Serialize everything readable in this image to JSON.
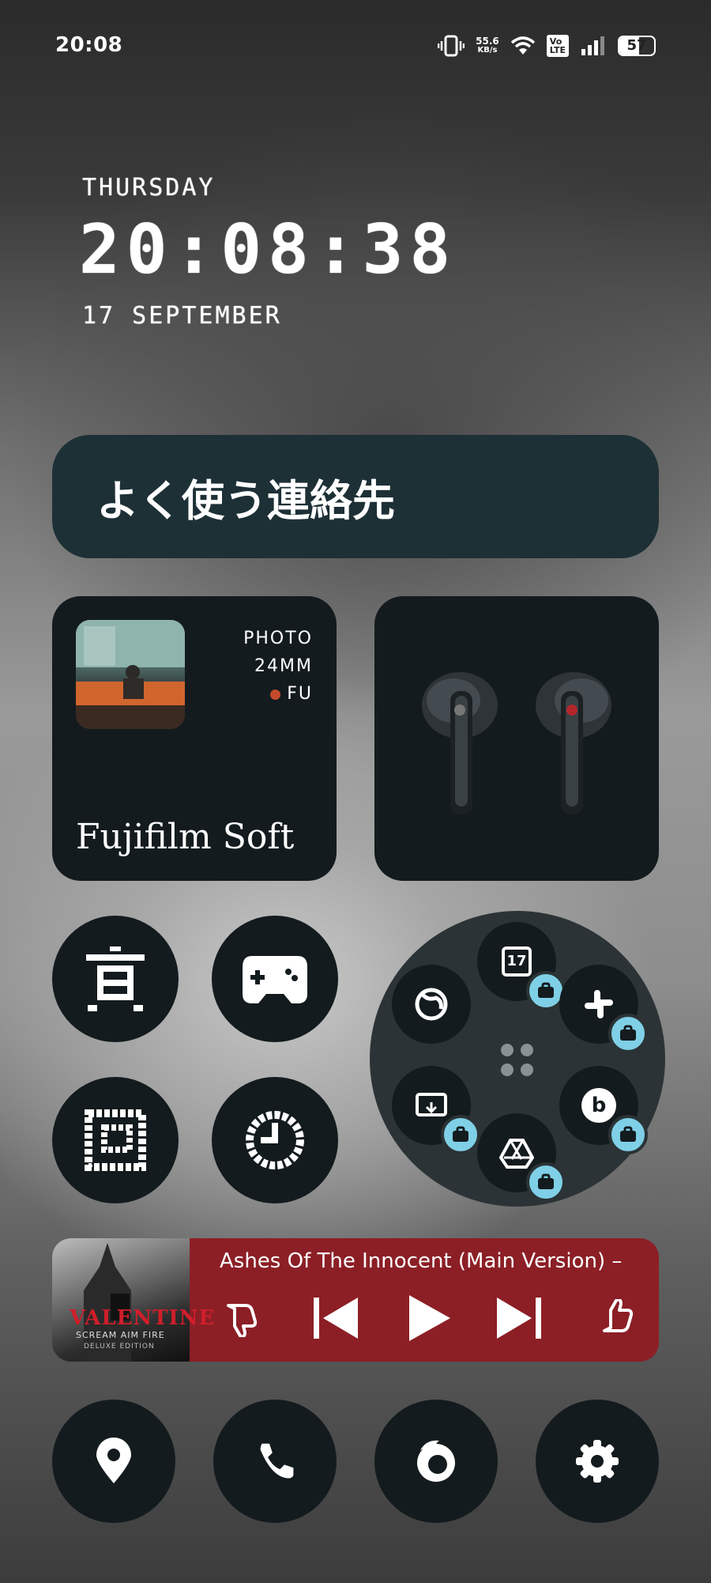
{
  "status_bar": {
    "time": "20:08",
    "net_speed_value": "55.6",
    "net_speed_unit": "KB/s",
    "volte_line1": "Vo",
    "volte_line2": "LTE",
    "battery": "57",
    "icons": [
      "vibrate-icon",
      "wifi-icon",
      "volte-icon",
      "signal-icon",
      "battery-icon"
    ]
  },
  "clock_widget": {
    "day": "THURSDAY",
    "time": "20:08:38",
    "date": "17 SEPTEMBER"
  },
  "contacts_widget": {
    "label": "よく使う連絡先"
  },
  "photo_widget": {
    "meta_line1": "PHOTO",
    "meta_line2": "24MM",
    "meta_line3": "FU",
    "title": "Fujifilm Soft"
  },
  "app_folder": {
    "calendar_day": "17",
    "apps": [
      "firefox-icon",
      "calendar-icon",
      "slack-icon",
      "bing-icon",
      "drive-icon",
      "remote-desktop-icon"
    ],
    "badge": "work-briefcase-icon"
  },
  "music_widget": {
    "album_title": "VALENTINE",
    "album_subtitle": "SCREAM AIM FIRE",
    "album_edition": "DELUXE EDITION",
    "track": "Ashes Of The Innocent (Main Version) –",
    "controls": [
      "thumbs-down-icon",
      "previous-icon",
      "play-icon",
      "next-icon",
      "thumbs-up-icon"
    ]
  },
  "dock": {
    "apps": [
      "maps-icon",
      "phone-icon",
      "firefox-icon",
      "settings-icon"
    ]
  },
  "colors": {
    "card_bg": "#131b1e",
    "contacts_bg": "#1d3036",
    "music_bg": "#8c1f26",
    "folder_bg": "#2b3336",
    "badge_blue": "#7fd0e6"
  }
}
